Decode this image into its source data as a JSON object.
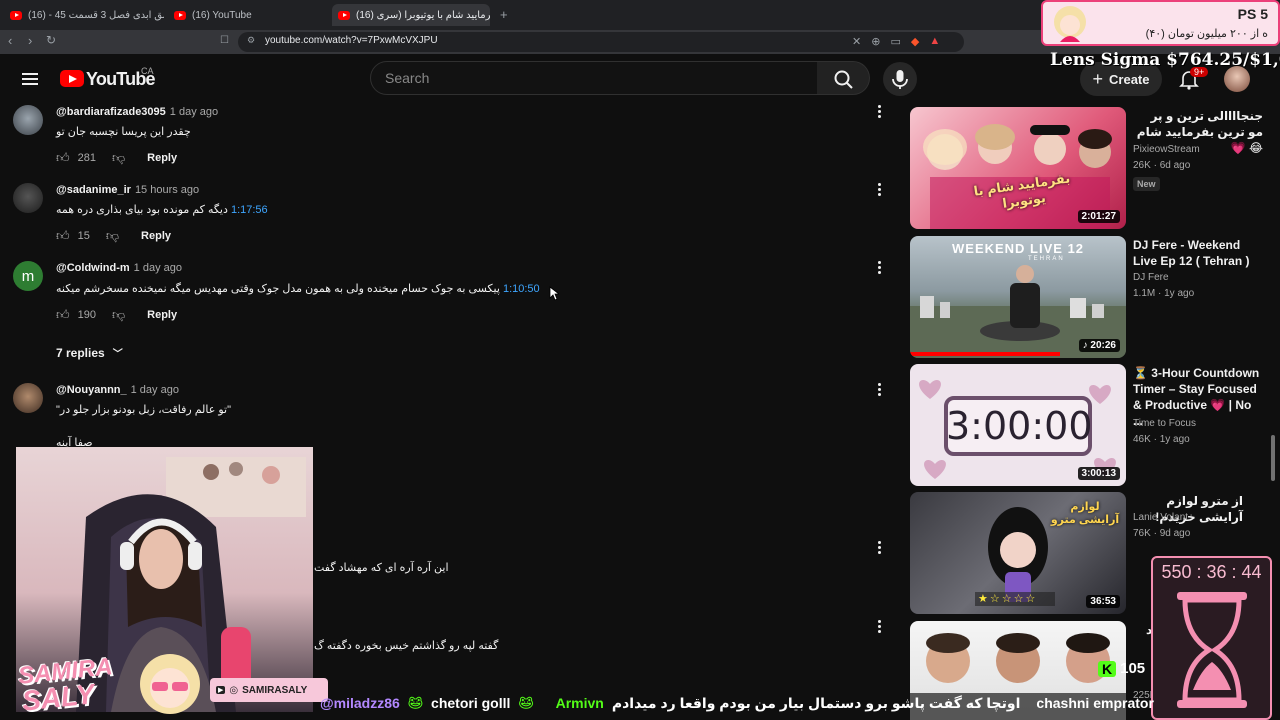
{
  "browser": {
    "tabs": [
      {
        "label": "عشق ابدی فصل 3 قسمت 45 - (16) ›e"
      },
      {
        "label": "(16) YouTube"
      },
      {
        "label": "(16) بفرمایید شام با یوتیوبرا (سری"
      }
    ],
    "url": "youtube.com/watch?v=7PxwMcVXJPU",
    "new_tab_glyph": "+"
  },
  "header": {
    "logo_text": "YouTube",
    "country": "CA",
    "search_placeholder": "Search",
    "create_label": "Create",
    "notification_count": "9+"
  },
  "comments": [
    {
      "author": "@bardiarafizade3095",
      "ago": "1 day ago",
      "text": "چقدر این پریسا نچسبه جان تو",
      "timestamp": "",
      "likes": "281",
      "reply_label": "Reply"
    },
    {
      "author": "@sadanime_ir",
      "ago": "15 hours ago",
      "text": "دیگه کم مونده بود بیای بذاری دره همه",
      "timestamp": "1:17:56",
      "likes": "15",
      "reply_label": "Reply"
    },
    {
      "author": "@Coldwind-m",
      "ago": "1 day ago",
      "text": "پیکسی به جوک حسام میخنده ولی به همون مدل جوک وقتی مهدیس میگه نمیخنده مسخرشم میکنه",
      "timestamp": "1:10:50",
      "likes": "190",
      "reply_label": "Reply",
      "avatar_letter": "m"
    },
    {
      "author": "@Nouyannn_",
      "ago": "1 day ago",
      "text": "\"تو عالم رفاقت، زبل بودنو بزار جلو در\"",
      "timestamp": "",
      "likes": "",
      "reply_label": "Reply"
    }
  ],
  "replies_toggle": "7 replies",
  "comment_partial": "صفا آینه",
  "comments_obscured": [
    {
      "text": "این آره آره ای که مهشاد گفت"
    },
    {
      "text": "گفته لپه رو گذاشتم خیس بخوره دگفته گ"
    }
  ],
  "sidebar": [
    {
      "title": "جنجاااالی ترین و پر مو ترین بفرمایید شام 😂 💗",
      "channel": "PixieowStream",
      "views": "26K",
      "ago": "6d ago",
      "badge": "New",
      "duration": "2:01:27",
      "thumb_text": "بفرمایید شام با یوتوبرا"
    },
    {
      "title": "DJ Fere - Weekend Live Ep 12 ( Tehran )",
      "channel": "DJ Fere",
      "views": "1.1M",
      "ago": "1y ago",
      "badge": "",
      "duration": "20:26",
      "thumb_text": "WEEKEND LIVE 12",
      "thumb_sub": "TEHRAN"
    },
    {
      "title": "⏳ 3-Hour Countdown Timer – Stay Focused & Productive 💗 | No ...",
      "channel": "Time to Focus",
      "views": "46K",
      "ago": "1y ago",
      "badge": "",
      "duration": "3:00:13",
      "thumb_text": "3:00:00"
    },
    {
      "title": "از مترو لوازم آرایشی خریدم!",
      "channel": "Lanie Volant",
      "views": "76K",
      "ago": "9d ago",
      "badge": "",
      "duration": "36:53",
      "thumb_text": "لوازم آرایشی مترو"
    },
    {
      "title": "E 1 ...رشد",
      "channel": "",
      "views": "225K",
      "ago": "",
      "badge": "",
      "duration": "",
      "thumb_text": ""
    }
  ],
  "overlay": {
    "ps_label": "PS 5",
    "ps_sub": "ه از ۲۰۰ میلیون تومان (۴۰)",
    "goal_text": "Lens Sigma $764.25/$1,000",
    "streamer_name_1": "SAMIRA",
    "streamer_name_2": "SALY",
    "social_handle": "SAMIRASALY",
    "timer": "550 : 36 : 44",
    "counter": "105",
    "counter_badge": "K",
    "chat": [
      {
        "user": "@miladzz86",
        "text": ""
      },
      {
        "user": "",
        "text": "chetori golll"
      },
      {
        "user": "Armivn",
        "text": "اوتچا که گفت پاشو برو دستمال بیار من بودم واقعا رد میدادم"
      },
      {
        "user": "",
        "text": "chashni emprator"
      }
    ]
  },
  "colors": {
    "yt_red": "#ff0000",
    "link_blue": "#3ea6ff",
    "overlay_pink": "#f48fb1"
  }
}
